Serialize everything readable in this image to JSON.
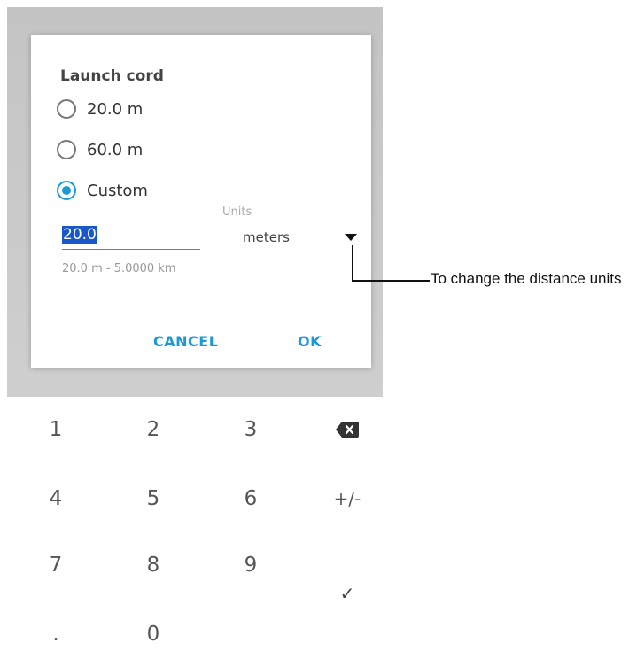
{
  "dialog": {
    "title": "Launch cord",
    "options": [
      {
        "label": "20.0 m",
        "checked": false
      },
      {
        "label": "60.0 m",
        "checked": false
      },
      {
        "label": "Custom",
        "checked": true
      }
    ],
    "units_label": "Units",
    "value": "20.0",
    "units_value": "meters",
    "range_hint": "20.0 m - 5.0000 km",
    "cancel_label": "CANCEL",
    "ok_label": "OK"
  },
  "keypad": {
    "keys": [
      "1",
      "2",
      "3",
      "4",
      "5",
      "6",
      "+/-",
      "7",
      "8",
      "9",
      ".",
      "0"
    ],
    "confirm_glyph": "✓"
  },
  "callout": {
    "text": "To change the distance units"
  },
  "colors": {
    "accent": "#1b9ad6",
    "selection": "#1a57c8",
    "overlay": "#c9c9c9"
  }
}
